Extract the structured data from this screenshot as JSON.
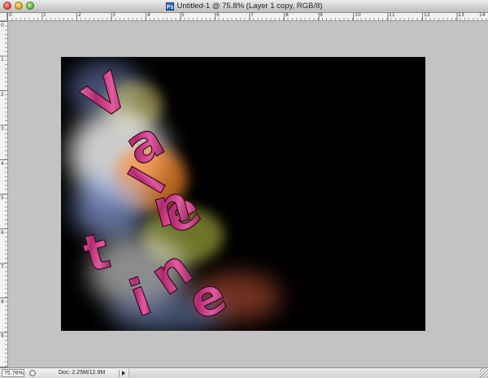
{
  "window": {
    "title": "Untitled-1 @ 75.8% (Layer 1 copy, RGB/8)",
    "app_icon": "photoshop-document-icon"
  },
  "rulers": {
    "top_labels": [
      "0",
      "1",
      "2",
      "3",
      "4",
      "5",
      "6",
      "7",
      "8",
      "9",
      "10",
      "11",
      "12",
      "13",
      "14"
    ],
    "left_labels": [
      "0",
      "1",
      "2",
      "3",
      "4",
      "5",
      "6",
      "7",
      "8",
      "9"
    ]
  },
  "artwork": {
    "text": "Valentine",
    "text_color": "#b02a6e",
    "background_color": "#000000"
  },
  "statusbar": {
    "zoom": "75.76%",
    "doc_info": "Doc: 2.25M/12.9M"
  }
}
